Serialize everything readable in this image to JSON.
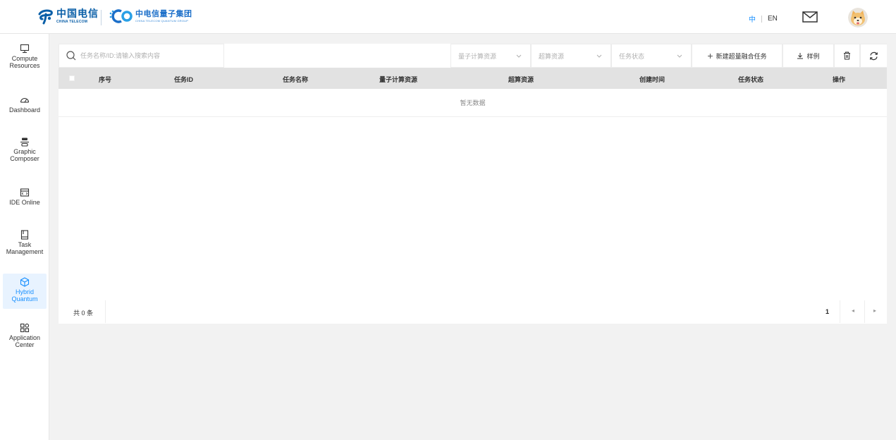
{
  "header": {
    "brand1_cn": "中国电信",
    "brand1_en": "CHINA TELECOM",
    "brand2_cn": "中电信量子集团",
    "brand2_en": "CHINA TELECOM QUANTUM GROUP",
    "lang_zh": "中",
    "lang_en": "EN",
    "icons": {
      "mail": "mail-icon",
      "avatar": "user-avatar"
    }
  },
  "sidebar": {
    "items": [
      {
        "label1": "Compute",
        "label2": "Resources",
        "icon": "monitor-icon"
      },
      {
        "label1": "Dashboard",
        "label2": "",
        "icon": "gauge-icon"
      },
      {
        "label1": "Graphic",
        "label2": "Composer",
        "icon": "circuit-icon"
      },
      {
        "label1": "IDE Online",
        "label2": "",
        "icon": "code-window-icon"
      },
      {
        "label1": "Task",
        "label2": "Management",
        "icon": "book-icon"
      },
      {
        "label1": "Hybrid",
        "label2": "Quantum",
        "icon": "cube-icon",
        "active": true
      },
      {
        "label1": "Application",
        "label2": "Center",
        "icon": "grid-icon"
      }
    ]
  },
  "toolbar": {
    "search_placeholder": "任务名称/ID:请输入搜索内容",
    "filter_quantum": "量子计算资源",
    "filter_supercomputing": "超算资源",
    "filter_status": "任务状态",
    "new_task_label": "新建超量融合任务",
    "sample_label": "样例"
  },
  "table": {
    "columns": [
      "序号",
      "任务ID",
      "任务名称",
      "量子计算资源",
      "超算资源",
      "创建时间",
      "任务状态",
      "操作"
    ],
    "empty_text": "暂无数据"
  },
  "pagination": {
    "total_text": "共 0 条",
    "current_page": "1"
  },
  "colors": {
    "accent": "#1890ff",
    "header_bg": "#ffffff",
    "table_header_bg": "#e2e2e2",
    "active_nav_bg": "#e8f3ff"
  }
}
